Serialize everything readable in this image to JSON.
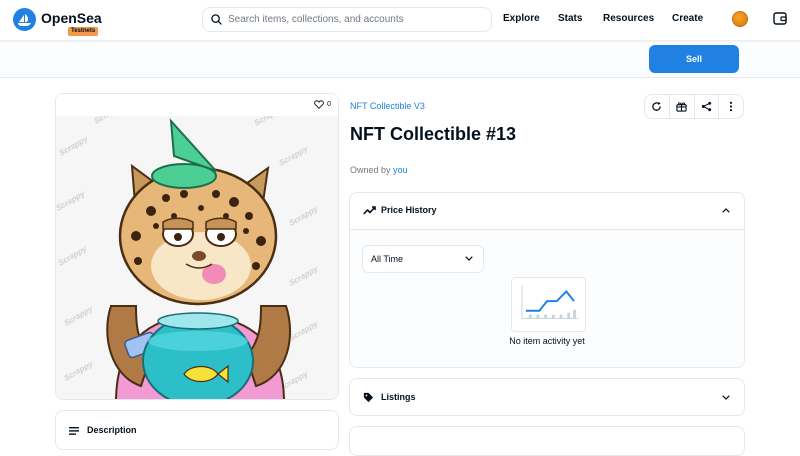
{
  "nav": {
    "brand": "OpenSea",
    "badge": "Testnets",
    "search_placeholder": "Search items, collections, and accounts",
    "links": [
      "Explore",
      "Stats",
      "Resources",
      "Create"
    ],
    "accent": "#2081e2"
  },
  "sell": {
    "label": "Sell"
  },
  "item": {
    "favorites": "0",
    "collection": "NFT Collectible V3",
    "title": "NFT Collectible #13",
    "owned_prefix": "Owned by ",
    "owner": "you",
    "watermark": "Scrappy Squirrels"
  },
  "price_history": {
    "title": "Price History",
    "range": "All Time",
    "empty": "No item activity yet"
  },
  "listings": {
    "title": "Listings"
  },
  "description": {
    "title": "Description"
  }
}
